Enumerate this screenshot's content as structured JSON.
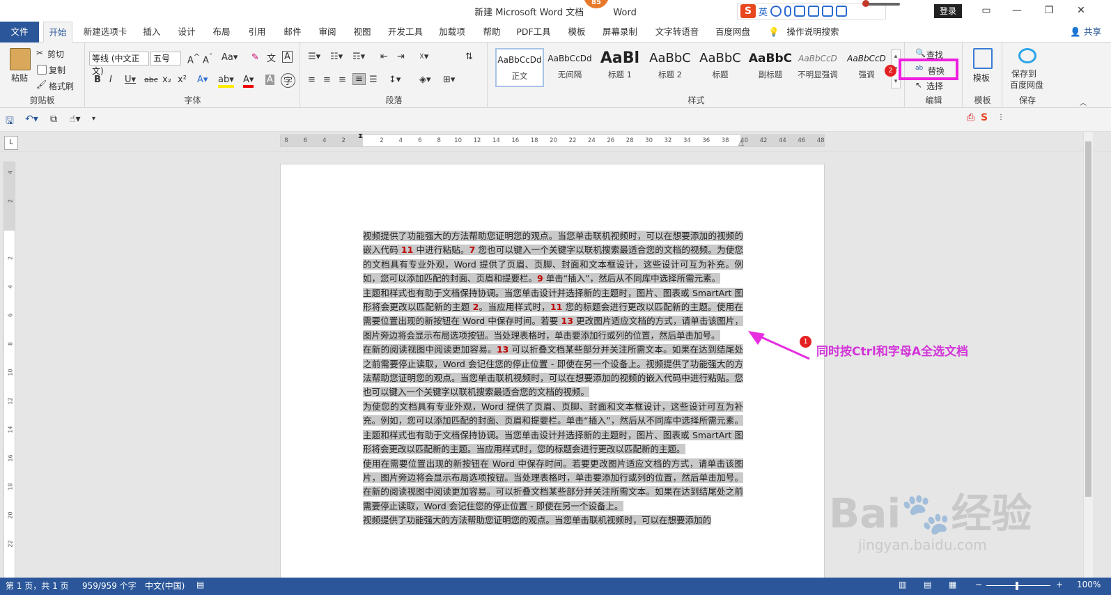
{
  "window": {
    "title": "新建 Microsoft Word 文档",
    "title_suffix": "Word",
    "badge": "85",
    "login": "登录",
    "ime_lang": "英"
  },
  "tabs": [
    {
      "label": "文件"
    },
    {
      "label": "开始"
    },
    {
      "label": "新建选项卡"
    },
    {
      "label": "插入"
    },
    {
      "label": "设计"
    },
    {
      "label": "布局"
    },
    {
      "label": "引用"
    },
    {
      "label": "邮件"
    },
    {
      "label": "审阅"
    },
    {
      "label": "视图"
    },
    {
      "label": "开发工具"
    },
    {
      "label": "加载项"
    },
    {
      "label": "帮助"
    },
    {
      "label": "PDF工具"
    },
    {
      "label": "模板"
    },
    {
      "label": "屏幕录制"
    },
    {
      "label": "文字转语音"
    },
    {
      "label": "百度网盘"
    },
    {
      "label": "操作说明搜索"
    }
  ],
  "share": "共享",
  "ribbon": {
    "clipboard": {
      "label": "剪贴板",
      "paste": "粘贴",
      "cut": "剪切",
      "copy": "复制",
      "painter": "格式刷"
    },
    "font": {
      "label": "字体",
      "family": "等线 (中文正文)",
      "size": "五号"
    },
    "paragraph": {
      "label": "段落"
    },
    "styles": {
      "label": "样式",
      "items": [
        {
          "sample": "AaBbCcDd",
          "name": "正文"
        },
        {
          "sample": "AaBbCcDd",
          "name": "无间隔"
        },
        {
          "sample": "AaBl",
          "name": "标题 1"
        },
        {
          "sample": "AaBbC",
          "name": "标题 2"
        },
        {
          "sample": "AaBbC",
          "name": "标题"
        },
        {
          "sample": "AaBbC",
          "name": "副标题"
        },
        {
          "sample": "AaBbCcD",
          "name": "不明显强调"
        },
        {
          "sample": "AaBbCcD",
          "name": "强调"
        }
      ]
    },
    "editing": {
      "label": "编辑",
      "find": "查找",
      "replace": "替换",
      "select": "选择"
    },
    "template": {
      "label": "模板",
      "btn": "模板"
    },
    "save": {
      "label": "保存",
      "btn1": "保存到",
      "btn2": "百度网盘"
    }
  },
  "ruler": {
    "h_ticks": [
      "8",
      "6",
      "4",
      "2",
      "2",
      "4",
      "6",
      "8",
      "10",
      "12",
      "14",
      "16",
      "18",
      "20",
      "22",
      "24",
      "26",
      "28",
      "30",
      "32",
      "34",
      "36",
      "38",
      "40",
      "42",
      "44",
      "46",
      "48"
    ],
    "v_ticks": [
      "4",
      "2",
      "2",
      "4",
      "6",
      "8",
      "10",
      "12",
      "14",
      "16",
      "18",
      "20",
      "22"
    ]
  },
  "document": {
    "paragraphs": [
      [
        {
          "t": "视频提供了功能强大的方法帮助您证明您的观点。当您单击联机视频时，可以在想要添加的视频的嵌入代码 "
        },
        {
          "t": "11",
          "n": true
        },
        {
          "t": " 中进行粘贴。"
        },
        {
          "t": "7",
          "n": true
        },
        {
          "t": " 您也可以键入一个关键字以联机搜索最适合您的文档的视频。为使您的文档具有专业外观，Word 提供了页眉、页脚、封面和文本框设计，这些设计可互为补充。例如，您可以添加匹配的封面、页眉和提要栏。"
        },
        {
          "t": "9",
          "n": true
        },
        {
          "t": " 单击“插入”，然后从不同库中选择所需元素。"
        }
      ],
      [
        {
          "t": "主题和样式也有助于文档保持协调。当您单击设计并选择新的主题时，图片、图表或 SmartArt 图形将会更改以匹配新的主题 "
        },
        {
          "t": "2",
          "n": true
        },
        {
          "t": "。当应用样式时，"
        },
        {
          "t": "11",
          "n": true
        },
        {
          "t": " 您的标题会进行更改以匹配新的主题。使用在需要位置出现的新按钮在 Word 中保存时间。若要 "
        },
        {
          "t": "13",
          "n": true
        },
        {
          "t": " 更改图片适应文档的方式，请单击该图片，图片旁边将会显示布局选项按钮。当处理表格时，单击要添加行或列的位置，然后单击加号。"
        }
      ],
      [
        {
          "t": "在新的阅读视图中阅读更加容易。"
        },
        {
          "t": "13",
          "n": true
        },
        {
          "t": " 可以折叠文档某些部分并关注所需文本。如果在达到结尾处之前需要停止读取，Word 会记住您的停止位置 - 即使在另一个设备上。视频提供了功能强大的方法帮助您证明您的观点。当您单击联机视频时，可以在想要添加的视频的嵌入代码中进行粘贴。您也可以键入一个关键字以联机搜索最适合您的文档的视频。"
        }
      ],
      [
        {
          "t": "为使您的文档具有专业外观，Word 提供了页眉、页脚、封面和文本框设计，这些设计可互为补充。例如，您可以添加匹配的封面、页眉和提要栏。单击“插入”，然后从不同库中选择所需元素。主题和样式也有助于文档保持协调。当您单击设计并选择新的主题时，图片、图表或 SmartArt 图形将会更改以匹配新的主题。当应用样式时，您的标题会进行更改以匹配新的主题。"
        }
      ],
      [
        {
          "t": "使用在需要位置出现的新按钮在 Word 中保存时间。若要更改图片适应文档的方式，请单击该图片，图片旁边将会显示布局选项按钮。当处理表格时，单击要添加行或列的位置，然后单击加号。在新的阅读视图中阅读更加容易。可以折叠文档某些部分并关注所需文本。如果在达到结尾处之前需要停止读取，Word 会记住您的停止位置 - 即使在另一个设备上。"
        }
      ],
      [
        {
          "t": "视频提供了功能强大的方法帮助您证明您的观点。当您单击联机视频时，可以在想要添加的"
        }
      ]
    ]
  },
  "annotation": {
    "step1_num": "1",
    "step1_text": "同时按Ctrl和字母A全选文档",
    "step2_num": "2"
  },
  "status": {
    "page": "第 1 页，共 1 页",
    "words": "959/959 个字",
    "lang": "中文(中国)",
    "zoom": "100%"
  },
  "watermark": {
    "main": "Bai",
    "sub": "jingyan.baidu.com",
    "brand": "经验"
  },
  "colors": {
    "accent": "#2b579a",
    "highlight": "#f01fe0",
    "number_red": "#c00000"
  }
}
